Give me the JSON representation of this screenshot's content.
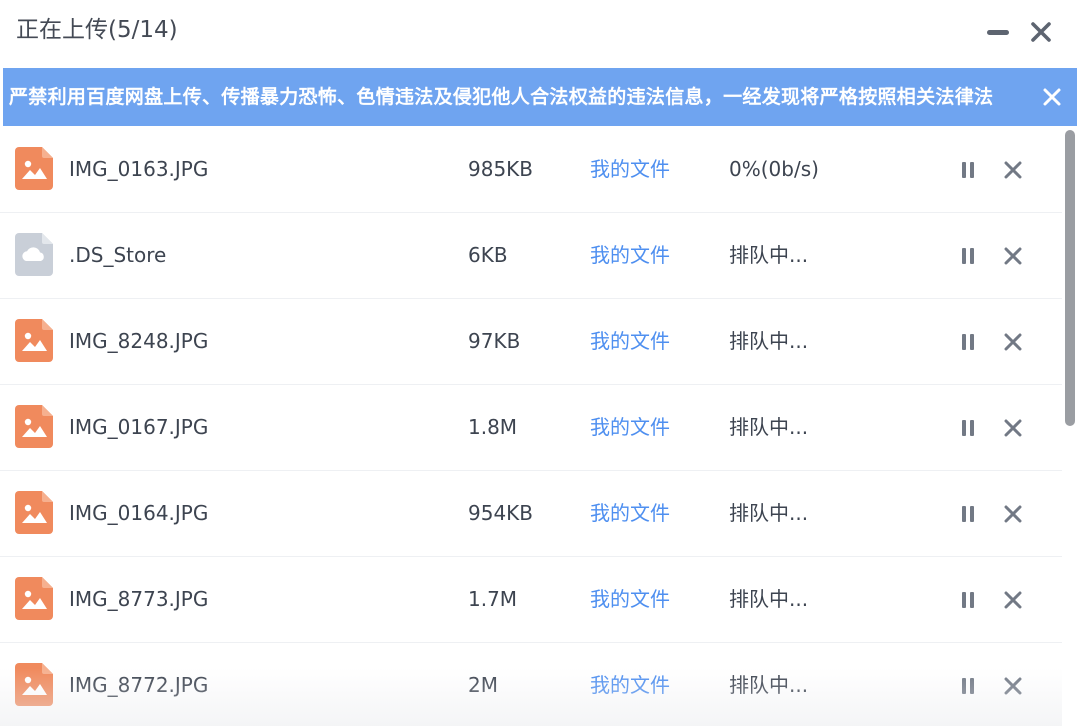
{
  "window": {
    "title": "正在上传(5/14)",
    "icons": {
      "minimize": "minimize-icon",
      "close": "close-icon"
    }
  },
  "notice": {
    "text": "严禁利用百度网盘上传、传播暴力恐怖、色情违法及侵犯他人合法权益的违法信息，一经发现将严格按照相关法律法",
    "bg_color": "#6fa4f0",
    "close_icon": "close-icon"
  },
  "uploads": [
    {
      "icon": "image-file-icon",
      "name": "IMG_0163.JPG",
      "size": "985KB",
      "destination": "我的文件",
      "status": "0%(0b/s)"
    },
    {
      "icon": "cloud-file-icon",
      "name": ".DS_Store",
      "size": "6KB",
      "destination": "我的文件",
      "status": "排队中..."
    },
    {
      "icon": "image-file-icon",
      "name": "IMG_8248.JPG",
      "size": "97KB",
      "destination": "我的文件",
      "status": "排队中..."
    },
    {
      "icon": "image-file-icon",
      "name": "IMG_0167.JPG",
      "size": "1.8M",
      "destination": "我的文件",
      "status": "排队中..."
    },
    {
      "icon": "image-file-icon",
      "name": "IMG_0164.JPG",
      "size": "954KB",
      "destination": "我的文件",
      "status": "排队中..."
    },
    {
      "icon": "image-file-icon",
      "name": "IMG_8773.JPG",
      "size": "1.7M",
      "destination": "我的文件",
      "status": "排队中..."
    },
    {
      "icon": "image-file-icon",
      "name": "IMG_8772.JPG",
      "size": "2M",
      "destination": "我的文件",
      "status": "排队中..."
    }
  ],
  "row_actions": {
    "pause_icon": "pause-icon",
    "cancel_icon": "close-icon"
  },
  "colors": {
    "accent_link": "#4e8ff0",
    "image_icon": "#f08a5d",
    "generic_icon": "#c9cfd8"
  }
}
